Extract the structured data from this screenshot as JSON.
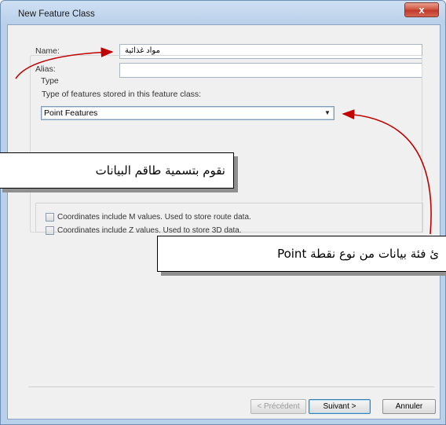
{
  "window": {
    "title": "New Feature Class",
    "close_glyph": "x"
  },
  "form": {
    "name_label": "Name:",
    "name_value": "مواد غذائية",
    "alias_label": "Alias:",
    "alias_value": "",
    "type_group_label": "Type",
    "type_desc": "Type of features stored in this feature class:",
    "type_selected": "Point Features",
    "checkbox_m": "Coordinates include M values. Used to store route data.",
    "checkbox_z": "Coordinates include Z values. Used to store 3D data."
  },
  "buttons": {
    "back": "< Précédent",
    "next": "Suivant >",
    "cancel": "Annuler"
  },
  "annotations": {
    "callout_name": "نقوم بتسمية طاقم البيانات",
    "callout_type": "ئ فئة بيانات من نوع نقطة Point"
  },
  "colors": {
    "arrow": "#c00000",
    "title_bar": "#b9d0ea",
    "close_button": "#c0392b"
  }
}
